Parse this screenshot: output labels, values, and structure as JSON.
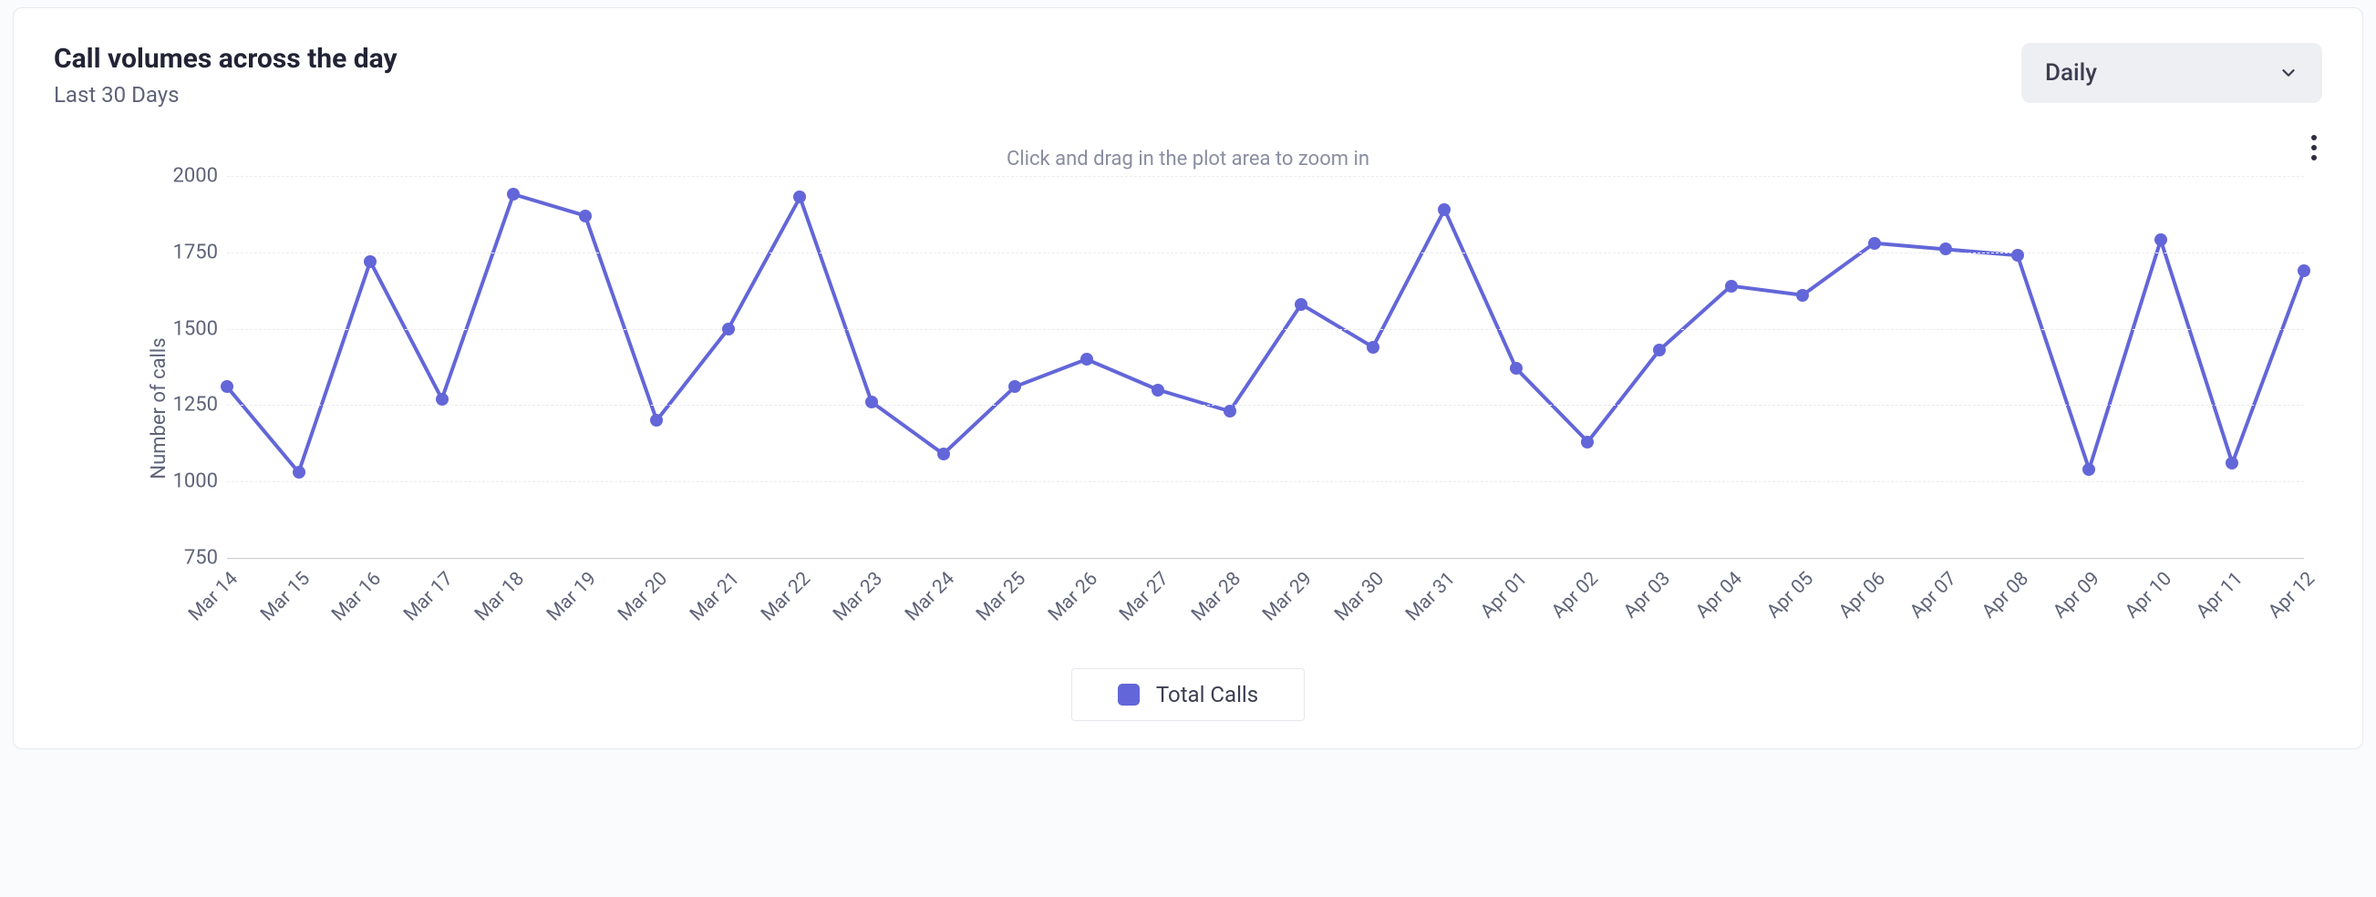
{
  "header": {
    "title": "Call volumes across the day",
    "subtitle": "Last 30 Days"
  },
  "dropdown": {
    "selected": "Daily"
  },
  "hint": "Click and drag in the plot area to zoom in",
  "ylabel": "Number of calls",
  "legend": {
    "series_label": "Total Calls"
  },
  "chart_data": {
    "type": "line",
    "title": "Call volumes across the day",
    "subtitle": "Last 30 Days",
    "xlabel": "",
    "ylabel": "Number of calls",
    "ylim": [
      750,
      2000
    ],
    "yticks": [
      750,
      1000,
      1250,
      1500,
      1750,
      2000
    ],
    "grid": true,
    "legend_position": "bottom",
    "series": [
      {
        "name": "Total Calls",
        "color": "#6366d8",
        "x": [
          "Mar 14",
          "Mar 15",
          "Mar 16",
          "Mar 17",
          "Mar 18",
          "Mar 19",
          "Mar 20",
          "Mar 21",
          "Mar 22",
          "Mar 23",
          "Mar 24",
          "Mar 25",
          "Mar 26",
          "Mar 27",
          "Mar 28",
          "Mar 29",
          "Mar 30",
          "Mar 31",
          "Apr 01",
          "Apr 02",
          "Apr 03",
          "Apr 04",
          "Apr 05",
          "Apr 06",
          "Apr 07",
          "Apr 08",
          "Apr 09",
          "Apr 10",
          "Apr 11",
          "Apr 12"
        ],
        "values": [
          1310,
          1030,
          1720,
          1270,
          1940,
          1870,
          1200,
          1500,
          1930,
          1260,
          1090,
          1310,
          1400,
          1300,
          1230,
          1580,
          1440,
          1890,
          1370,
          1130,
          1430,
          1640,
          1610,
          1780,
          1760,
          1740,
          1040,
          1790,
          1060,
          1690
        ]
      }
    ]
  }
}
